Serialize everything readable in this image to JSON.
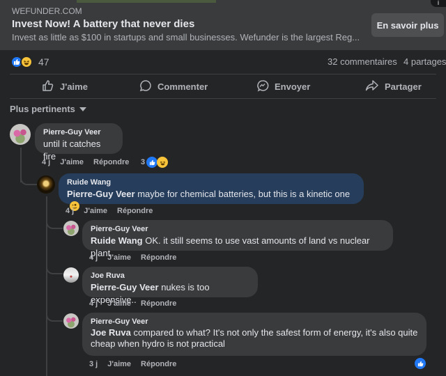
{
  "ad": {
    "domain": "WEFUNDER.COM",
    "title": "Invest Now! A battery that never dies",
    "description": "Invest as little as $100 in startups and small businesses. Wefunder is the largest Reg...",
    "cta": "En savoir plus"
  },
  "summary": {
    "reaction_count": "47",
    "comments": "32 commentaires",
    "shares": "4 partages"
  },
  "actions": {
    "like": "J'aime",
    "comment": "Commenter",
    "send": "Envoyer",
    "share": "Partager"
  },
  "sort_label": "Plus pertinents",
  "comments": [
    {
      "author": "Pierre-Guy Veer",
      "text": "until it catches fire",
      "time": "4 j",
      "like": "J'aime",
      "reply": "Répondre",
      "reactions": "3"
    },
    {
      "author": "Ruide Wang",
      "mention": "Pierre-Guy Veer",
      "text": "maybe for chemical batteries, but this is a kinetic one",
      "time": "4 j",
      "like": "J'aime",
      "reply": "Répondre"
    },
    {
      "author": "Pierre-Guy Veer",
      "mention": "Ruide Wang",
      "text": "OK. it still seems to use vast amounts of land vs nuclear plant",
      "time": "4 j",
      "like": "J'aime",
      "reply": "Répondre"
    },
    {
      "author": "Joe Ruva",
      "mention": "Pierre-Guy Veer",
      "text": "nukes is too expensive..",
      "time": "4 j",
      "like": "J'aime",
      "reply": "Répondre"
    },
    {
      "author": "Pierre-Guy Veer",
      "mention": "Joe Ruva",
      "text_line1": "compared to what? It's not only the safest form of energy, it's also quite",
      "text_line2": "cheap when hydro is not practical",
      "time": "3 j",
      "like": "J'aime",
      "reply": "Répondre"
    }
  ],
  "colors": {
    "background": "#242526",
    "bubble": "#3a3b3c",
    "highlight_bubble": "#263e5c",
    "like_blue": "#2078f4",
    "haha_yellow": "#f7c33a"
  }
}
